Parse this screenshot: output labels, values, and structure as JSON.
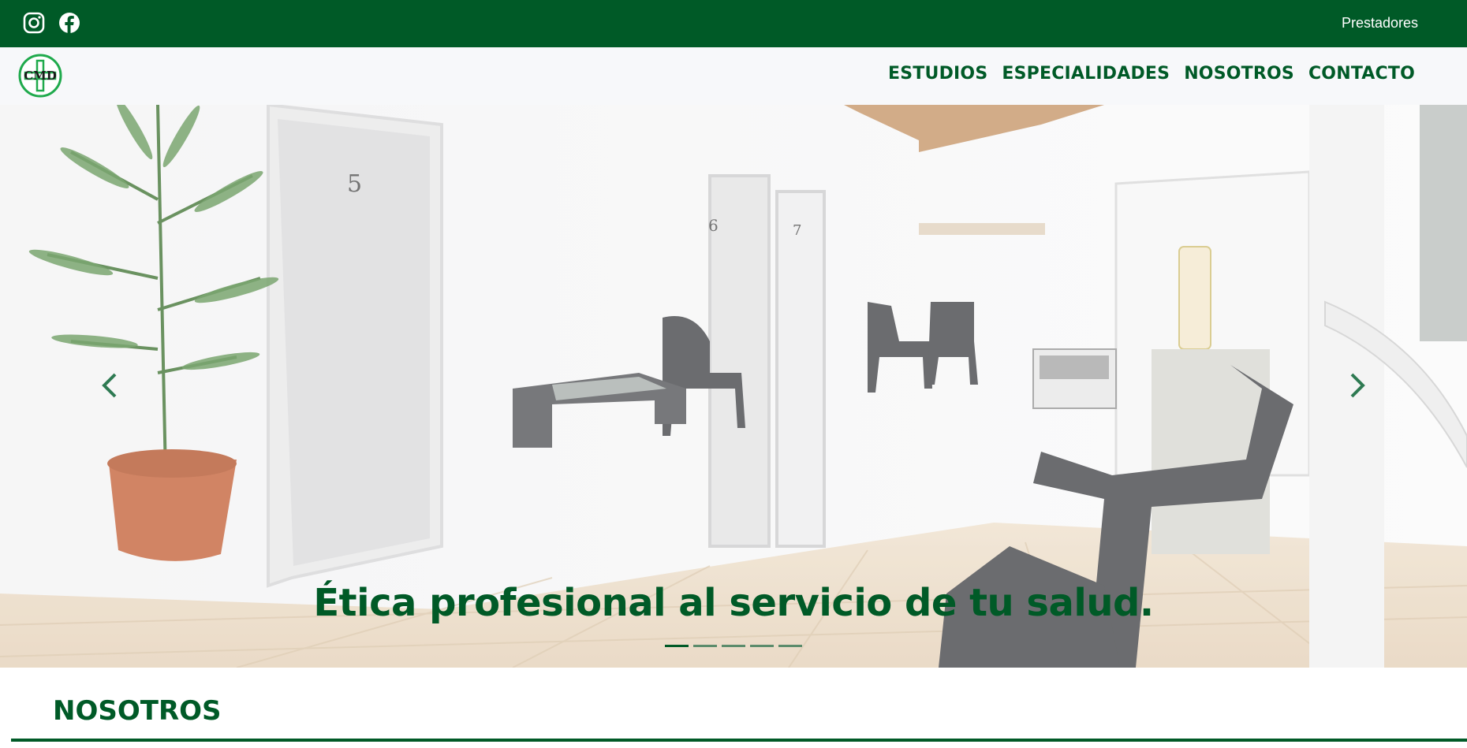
{
  "topbar": {
    "social_icons": [
      "instagram-icon",
      "facebook-icon"
    ],
    "prestadores_label": "Prestadores"
  },
  "navbar": {
    "logo_text": "CMD",
    "menu": [
      {
        "label": "ESTUDIOS"
      },
      {
        "label": "ESPECIALIDADES"
      },
      {
        "label": "NOSOTROS"
      },
      {
        "label": "CONTACTO"
      }
    ]
  },
  "hero": {
    "caption": "Ética profesional al servicio de tu salud.",
    "slide_count": 5,
    "active_slide": 1,
    "prev_icon": "chevron-left-icon",
    "next_icon": "chevron-right-icon",
    "door_numbers": [
      "5",
      "6",
      "7"
    ]
  },
  "section": {
    "title": "NOSOTROS"
  },
  "colors": {
    "brand_green": "#005a27",
    "nav_bg": "#f7f8fa",
    "white": "#ffffff"
  }
}
